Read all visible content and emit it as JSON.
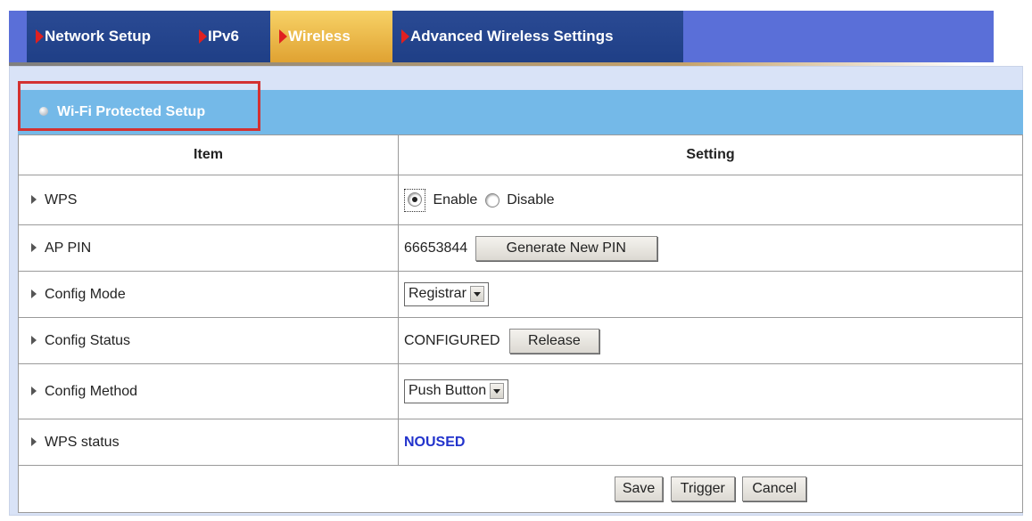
{
  "tabs": [
    {
      "label": "Network Setup"
    },
    {
      "label": "IPv6"
    },
    {
      "label": "Wireless"
    },
    {
      "label": "Advanced Wireless Settings"
    }
  ],
  "section": {
    "title": "Wi-Fi Protected Setup"
  },
  "table": {
    "headers": {
      "item": "Item",
      "setting": "Setting"
    },
    "rows": [
      {
        "label": "WPS"
      },
      {
        "label": "AP PIN"
      },
      {
        "label": "Config Mode"
      },
      {
        "label": "Config Status"
      },
      {
        "label": "Config Method"
      },
      {
        "label": "WPS status"
      }
    ]
  },
  "wps": {
    "enable_label": "Enable",
    "disable_label": "Disable",
    "selected": "Enable"
  },
  "ap_pin": {
    "value": "66653844",
    "generate_label": "Generate New PIN"
  },
  "config_mode": {
    "selected": "Registrar"
  },
  "config_status": {
    "value": "CONFIGURED",
    "release_label": "Release"
  },
  "config_method": {
    "selected": "Push Button"
  },
  "wps_status": {
    "value": "NOUSED"
  },
  "footer": {
    "save_label": "Save",
    "trigger_label": "Trigger",
    "cancel_label": "Cancel"
  },
  "colors": {
    "tab_bar": "#2a4a94",
    "active_tab": "#e0a232",
    "section_header": "#74b9e8",
    "highlight": "#d33131",
    "status_text": "#2233cc"
  }
}
